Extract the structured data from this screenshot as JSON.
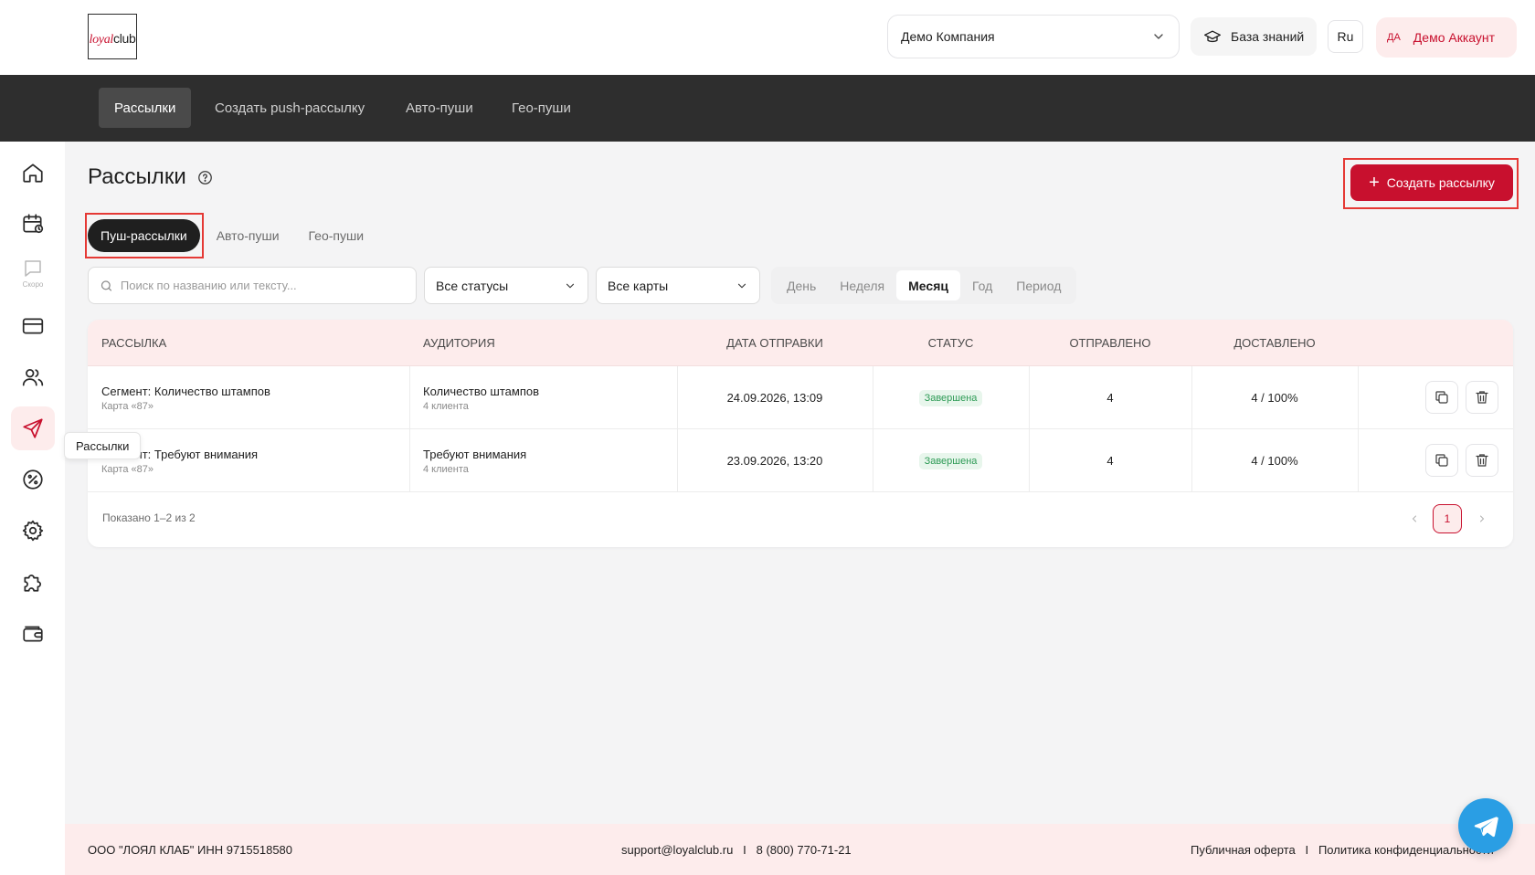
{
  "header": {
    "logo": {
      "loyal": "loyal",
      "club": "club"
    },
    "company_select": "Демо Компания",
    "knowledge_base": "База знаний",
    "language": "Ru",
    "account_initials": "ДА",
    "account_name": "Демо Аккаунт"
  },
  "topnav": {
    "items": [
      "Рассылки",
      "Создать push-рассылку",
      "Авто-пуши",
      "Гео-пуши"
    ],
    "active": "Рассылки"
  },
  "sidebar": {
    "items": [
      {
        "icon": "home-icon",
        "label": ""
      },
      {
        "icon": "calendar-icon",
        "label": ""
      },
      {
        "icon": "chat-icon",
        "label": "Скоро"
      },
      {
        "icon": "card-icon",
        "label": ""
      },
      {
        "icon": "users-icon",
        "label": ""
      },
      {
        "icon": "send-icon",
        "label": ""
      },
      {
        "icon": "percent-icon",
        "label": ""
      },
      {
        "icon": "gear-icon",
        "label": ""
      },
      {
        "icon": "puzzle-icon",
        "label": ""
      },
      {
        "icon": "wallet-icon",
        "label": ""
      }
    ],
    "tooltip": "Рассылки"
  },
  "main": {
    "title": "Рассылки",
    "create_button": "Создать рассылку",
    "tabs": [
      "Пуш-рассылки",
      "Авто-пуши",
      "Гео-пуши"
    ],
    "active_tab": "Пуш-рассылки",
    "search_placeholder": "Поиск по названию или тексту...",
    "status_filter": "Все статусы",
    "cards_filter": "Все карты",
    "periods": [
      "День",
      "Неделя",
      "Месяц",
      "Год",
      "Период"
    ],
    "active_period": "Месяц"
  },
  "table": {
    "columns": [
      "РАССЫЛКА",
      "АУДИТОРИЯ",
      "ДАТА ОТПРАВКИ",
      "СТАТУС",
      "ОТПРАВЛЕНО",
      "ДОСТАВЛЕНО"
    ],
    "rows": [
      {
        "name": "Сегмент: Количество штампов",
        "card": "Карта «87»",
        "audience": "Количество штампов",
        "audience_count": "4 клиента",
        "date": "24.09.2026, 13:09",
        "status": "Завершена",
        "sent": "4",
        "delivered": "4 / 100%"
      },
      {
        "name": "Сегмент: Требуют внимания",
        "card": "Карта «87»",
        "audience": "Требуют внимания",
        "audience_count": "4 клиента",
        "date": "23.09.2026, 13:20",
        "status": "Завершена",
        "sent": "4",
        "delivered": "4 / 100%"
      }
    ],
    "shown_text": "Показано 1–2 из 2",
    "current_page": "1"
  },
  "footer": {
    "company": "ООО \"ЛОЯЛ КЛАБ\" ИНН 9715518580",
    "contacts": "support@loyalclub.ru   I   8 (800) 770-71-21",
    "links": "Публичная оферта   I   Политика конфиденциальности"
  },
  "colors": {
    "brand": "#c8102e",
    "nav_bg": "#2e2e2e",
    "header_row": "#fdecec",
    "status_green": "#2e9b56",
    "telegram": "#2a9ee4"
  }
}
